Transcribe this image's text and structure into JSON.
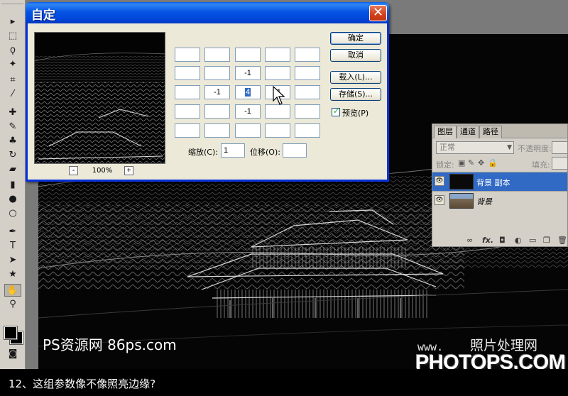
{
  "dialog": {
    "title": "自定",
    "close_label": "✕",
    "zoom_level": "100%",
    "zoom_out_label": "-",
    "zoom_in_label": "+",
    "matrix": [
      [
        "",
        "",
        "",
        "",
        ""
      ],
      [
        "",
        "",
        "-1",
        "",
        ""
      ],
      [
        "",
        "-1",
        "4",
        "-1",
        ""
      ],
      [
        "",
        "",
        "-1",
        "",
        ""
      ],
      [
        "",
        "",
        "",
        "",
        ""
      ]
    ],
    "scale_label": "缩放(C):",
    "scale_value": "1",
    "offset_label": "位移(O):",
    "offset_value": "",
    "buttons": {
      "ok": "确定",
      "cancel": "取消",
      "load": "载入(L)...",
      "save": "存储(S)..."
    },
    "preview_label": "预览(P)",
    "preview_checked": true
  },
  "layers_panel": {
    "tabs": [
      "图层",
      "通道",
      "路径"
    ],
    "blend_mode": "正常",
    "opacity_label": "不透明度:",
    "lock_label": "锁定:",
    "fill_label": "填充:",
    "layers": [
      {
        "name": "背景 副本",
        "selected": true
      },
      {
        "name": "背景",
        "selected": false
      }
    ],
    "footer_icons": [
      "link-icon",
      "fx-icon",
      "mask-icon",
      "adjustment-icon",
      "group-icon",
      "new-layer-icon",
      "trash-icon"
    ]
  },
  "tools": [
    "move-icon",
    "marquee-icon",
    "lasso-icon",
    "magic-wand-icon",
    "crop-icon",
    "eyedropper-icon",
    "healing-icon",
    "brush-icon",
    "stamp-icon",
    "history-brush-icon",
    "eraser-icon",
    "gradient-icon",
    "blur-icon",
    "dodge-icon",
    "pen-icon",
    "type-icon",
    "path-select-icon",
    "shape-icon",
    "hand-icon",
    "zoom-icon"
  ],
  "watermarks": {
    "left": "PS资源网 86ps.com",
    "small": "www.",
    "cn": "照片处理网",
    "big": "PHOTOPS.COM"
  },
  "caption": "12、这组参数像不像照亮边缘?"
}
